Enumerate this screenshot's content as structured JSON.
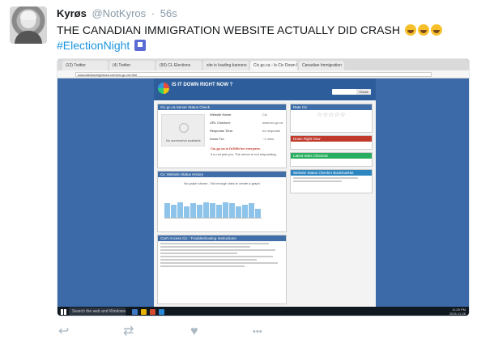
{
  "tweet": {
    "display_name": "Kyrøs",
    "handle": "@NotKyros",
    "separator": "·",
    "time": "56s",
    "text": "THE CANADIAN IMMIGRATION WEBSITE ACTUALLY DID CRASH",
    "emoji_count": 3,
    "hashtag": "#ElectionNight"
  },
  "screenshot": {
    "tabs": [
      "(12) Twitter",
      "(4) Twitter",
      "(90) CL Elections",
      "site is loading banners",
      "Cic.gc.ca - Is Cic Down h",
      "Canadian Immigration"
    ],
    "address": "www.isitdownrightnow.com/cic.gc.ca.html",
    "site": {
      "title": "IS IT DOWN RIGHT NOW ?",
      "search_button": "Check",
      "status_title": "Cic.gc.ca Server Status Check",
      "placeholder_text": "No screenshot available",
      "fields": [
        {
          "label": "Website Name:",
          "value": "Cic"
        },
        {
          "label": "URL Checked:",
          "value": "www.cic.gc.ca"
        },
        {
          "label": "Response Time:",
          "value": "no response"
        },
        {
          "label": "Down For:",
          "value": "~1 mins"
        }
      ],
      "down_message": "Cic.gc.ca is DOWN for everyone.",
      "down_sub": "It is not just you. The server is not responding.",
      "history_title": "Cic Website Status History",
      "history_note": "No graph shown - Not enough data to create a graph",
      "troubleshoot_title": "Can't Access Cic : Troubleshooting Instructions",
      "rate_title": "Rate Cic",
      "down_now_title": "Down Right Now",
      "latest_title": "Latest Sites Checked",
      "checker_title": "Website Status Checker Bookmarklet"
    },
    "taskbar": {
      "search_text": "Search the web and Windows",
      "time": "11:29 PM",
      "date": "2016-11-08"
    }
  },
  "bars": [
    0.55,
    0.5,
    0.6,
    0.45,
    0.55,
    0.5,
    0.6,
    0.55,
    0.5,
    0.6,
    0.55,
    0.45,
    0.5,
    0.55,
    0.35
  ],
  "actions": {
    "reply": "↩",
    "retweet": "⇄",
    "like": "♥",
    "more": "•••"
  },
  "colors": {
    "hashtag": "#1b95e0",
    "muted": "#8899a6",
    "action": "#aab8c2"
  }
}
